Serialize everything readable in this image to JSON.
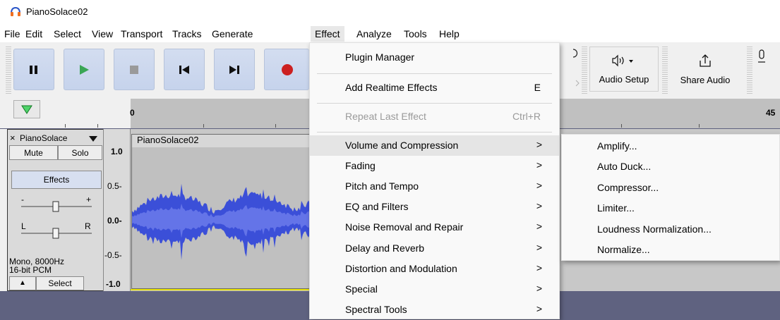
{
  "window": {
    "title": "PianoSolace02"
  },
  "menubar": {
    "items": [
      "File",
      "Edit",
      "Select",
      "View",
      "Transport",
      "Tracks",
      "Generate",
      "Effect",
      "Analyze",
      "Tools",
      "Help"
    ],
    "active": "Effect"
  },
  "toolbar": {
    "audio_setup_label": "Audio Setup",
    "share_audio_label": "Share Audio"
  },
  "timeline": {
    "tick_start": "0",
    "tick_end": "45"
  },
  "track": {
    "name": "PianoSolace",
    "mute_label": "Mute",
    "solo_label": "Solo",
    "effects_label": "Effects",
    "gain_minus": "-",
    "gain_plus": "+",
    "pan_left": "L",
    "pan_right": "R",
    "format_line1": "Mono, 8000Hz",
    "format_line2": "16-bit PCM",
    "select_label": "Select",
    "scale": [
      "1.0",
      "0.5-",
      "0.0-",
      "-0.5-",
      "-1.0"
    ],
    "close_glyph": "×",
    "collapse_glyph": "▲"
  },
  "clip": {
    "name": "PianoSolace02"
  },
  "effect_menu": {
    "items": [
      {
        "label": "Plugin Manager",
        "shortcut": "",
        "submenu": false,
        "disabled": false
      },
      {
        "label": "Add Realtime Effects",
        "shortcut": "E",
        "submenu": false,
        "disabled": false
      },
      {
        "label": "Repeat Last Effect",
        "shortcut": "Ctrl+R",
        "submenu": false,
        "disabled": true
      },
      {
        "label": "Volume and Compression",
        "shortcut": "",
        "submenu": true,
        "disabled": false
      },
      {
        "label": "Fading",
        "shortcut": "",
        "submenu": true,
        "disabled": false
      },
      {
        "label": "Pitch and Tempo",
        "shortcut": "",
        "submenu": true,
        "disabled": false
      },
      {
        "label": "EQ and Filters",
        "shortcut": "",
        "submenu": true,
        "disabled": false
      },
      {
        "label": "Noise Removal and Repair",
        "shortcut": "",
        "submenu": true,
        "disabled": false
      },
      {
        "label": "Delay and Reverb",
        "shortcut": "",
        "submenu": true,
        "disabled": false
      },
      {
        "label": "Distortion and Modulation",
        "shortcut": "",
        "submenu": true,
        "disabled": false
      },
      {
        "label": "Special",
        "shortcut": "",
        "submenu": true,
        "disabled": false
      },
      {
        "label": "Spectral Tools",
        "shortcut": "",
        "submenu": true,
        "disabled": false
      }
    ],
    "arrow_glyph": ">"
  },
  "submenu": {
    "items": [
      "Amplify...",
      "Auto Duck...",
      "Compressor...",
      "Limiter...",
      "Loudness Normalization...",
      "Normalize..."
    ]
  },
  "colors": {
    "play_green": "#3aa655",
    "record_red": "#cc2020",
    "waveform_blue": "#3b4fd8",
    "selected_wave": "#5060e0"
  }
}
